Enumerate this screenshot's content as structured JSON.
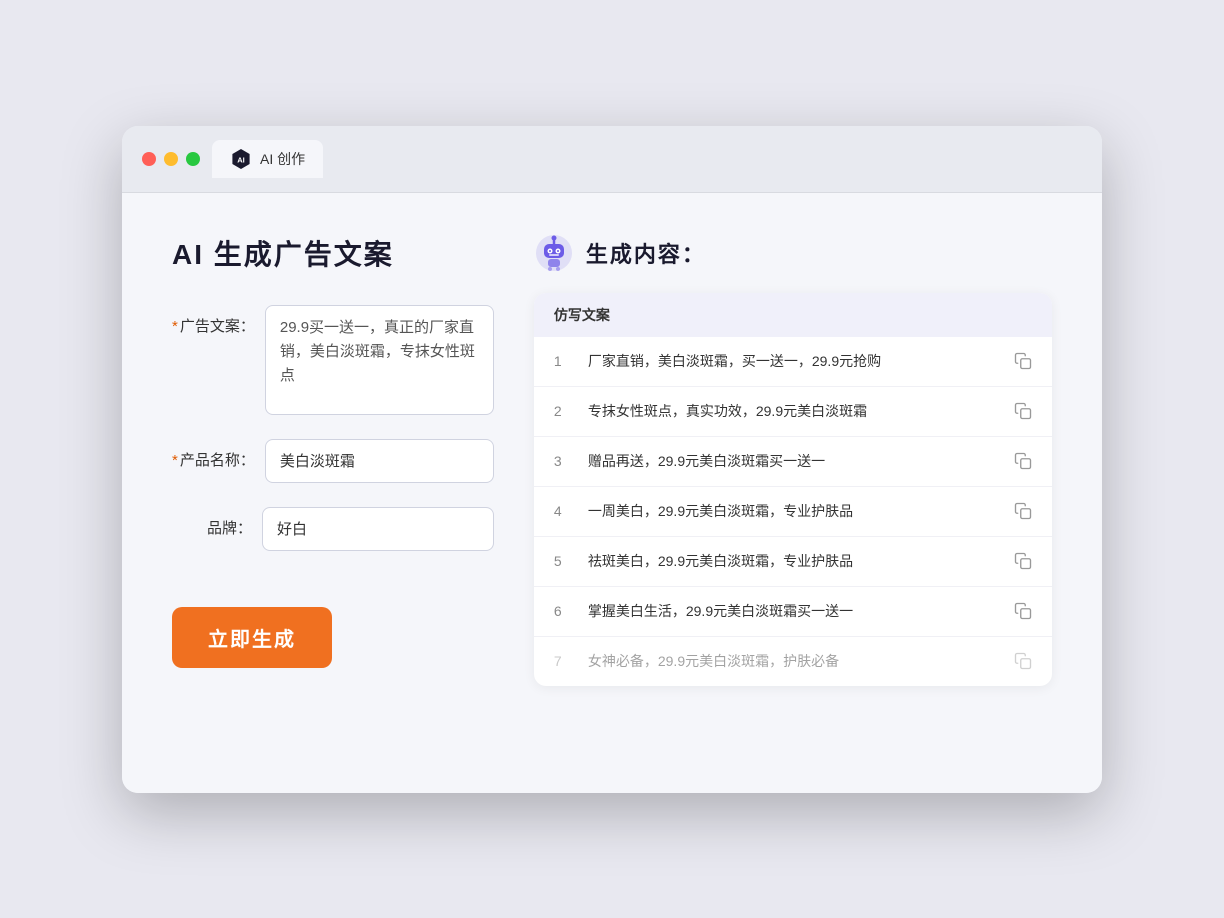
{
  "browser": {
    "tab_label": "AI 创作"
  },
  "page": {
    "title": "AI 生成广告文案"
  },
  "form": {
    "ad_copy_label": "广告文案：",
    "ad_copy_required": true,
    "ad_copy_value": "29.9买一送一，真正的厂家直销，美白淡斑霜，专抹女性斑点",
    "product_name_label": "产品名称：",
    "product_name_required": true,
    "product_name_value": "美白淡斑霜",
    "brand_label": "品牌：",
    "brand_required": false,
    "brand_value": "好白",
    "generate_button": "立即生成"
  },
  "results": {
    "title": "生成内容：",
    "column_header": "仿写文案",
    "items": [
      {
        "num": "1",
        "text": "厂家直销，美白淡斑霜，买一送一，29.9元抢购",
        "dimmed": false
      },
      {
        "num": "2",
        "text": "专抹女性斑点，真实功效，29.9元美白淡斑霜",
        "dimmed": false
      },
      {
        "num": "3",
        "text": "赠品再送，29.9元美白淡斑霜买一送一",
        "dimmed": false
      },
      {
        "num": "4",
        "text": "一周美白，29.9元美白淡斑霜，专业护肤品",
        "dimmed": false
      },
      {
        "num": "5",
        "text": "祛斑美白，29.9元美白淡斑霜，专业护肤品",
        "dimmed": false
      },
      {
        "num": "6",
        "text": "掌握美白生活，29.9元美白淡斑霜买一送一",
        "dimmed": false
      },
      {
        "num": "7",
        "text": "女神必备，29.9元美白淡斑霜，护肤必备",
        "dimmed": true
      }
    ]
  }
}
